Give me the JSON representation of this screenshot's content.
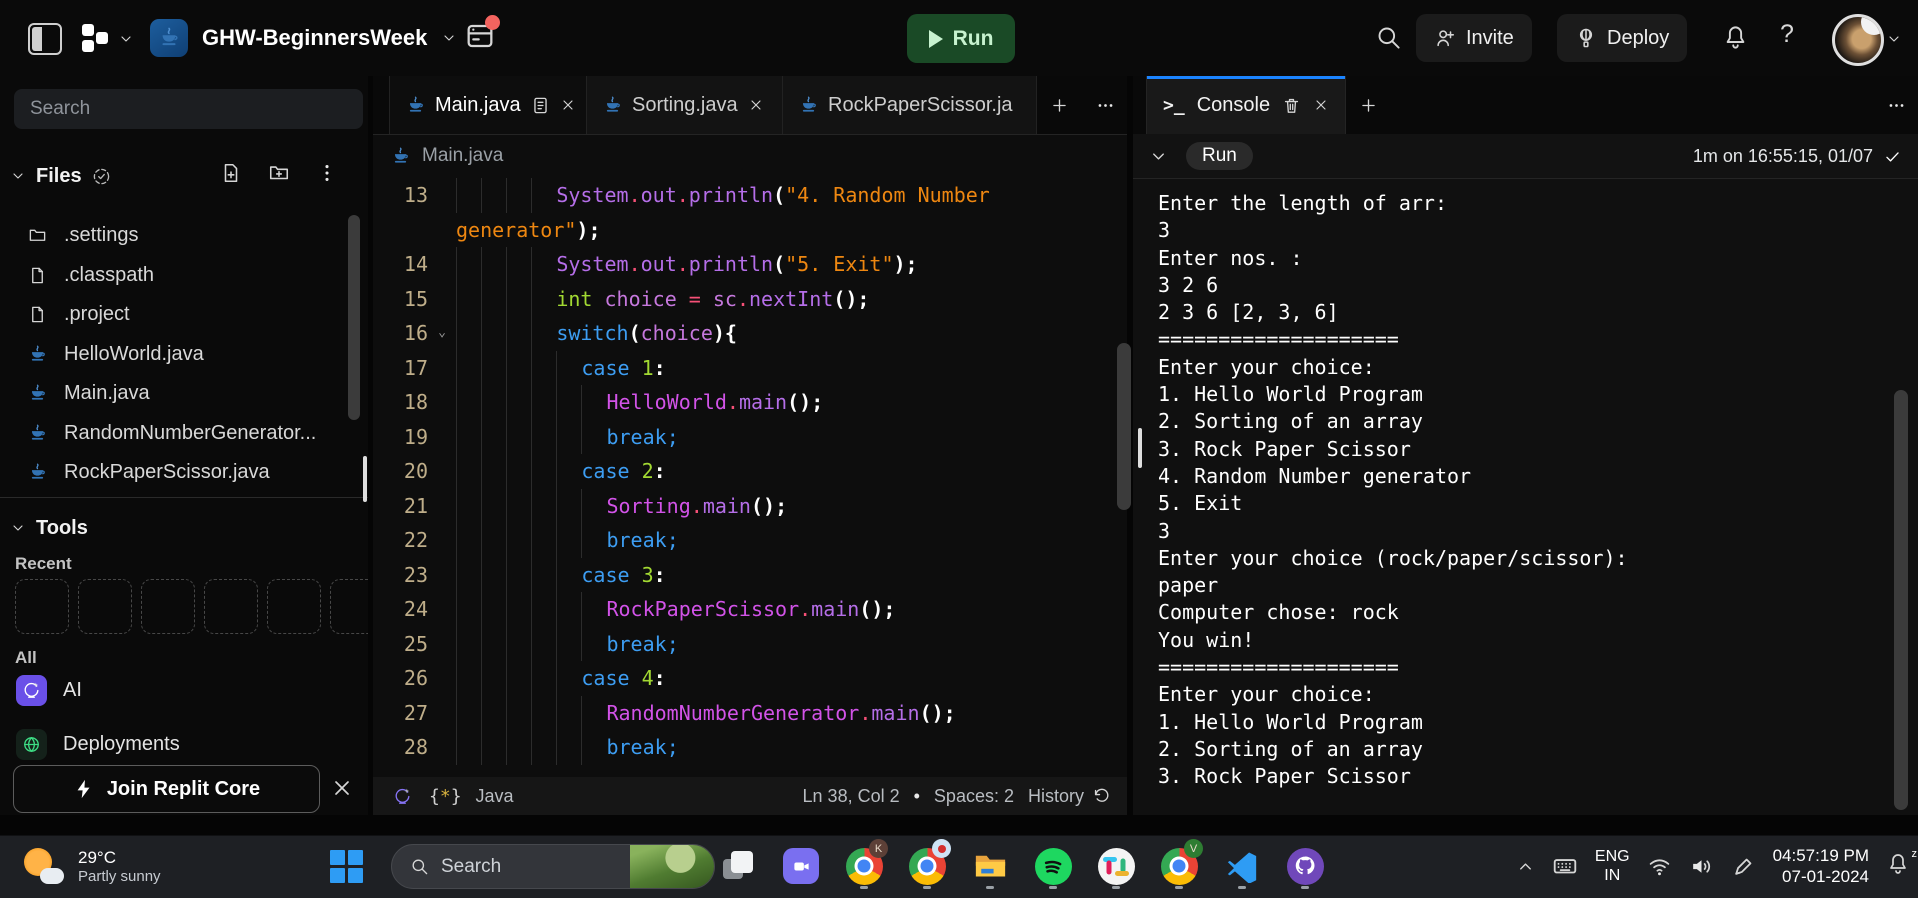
{
  "topbar": {
    "project_name": "GHW-BeginnersWeek",
    "run_label": "Run",
    "invite_label": "Invite",
    "deploy_label": "Deploy",
    "help_label": "?",
    "colors": {
      "run_bg": "#1a4a26",
      "run_text": "#c7f2cf",
      "accent_blue": "#1b84ff",
      "notification_red": "#f4645f"
    }
  },
  "sidebar": {
    "search_placeholder": "Search",
    "files_label": "Files",
    "tools_label": "Tools",
    "recent_label": "Recent",
    "all_label": "All",
    "ai_label": "AI",
    "deployments_label": "Deployments",
    "banner_label": "Join Replit Core",
    "files": [
      {
        "name": ".settings",
        "icon": "folder"
      },
      {
        "name": ".classpath",
        "icon": "file"
      },
      {
        "name": ".project",
        "icon": "file"
      },
      {
        "name": "HelloWorld.java",
        "icon": "java"
      },
      {
        "name": "Main.java",
        "icon": "java"
      },
      {
        "name": "RandomNumberGenerator...",
        "icon": "java"
      },
      {
        "name": "RockPaperScissor.java",
        "icon": "java"
      }
    ]
  },
  "editor": {
    "tabs": [
      {
        "label": "Main.java",
        "active": true,
        "doc": true,
        "close": true
      },
      {
        "label": "Sorting.java",
        "active": false,
        "doc": false,
        "close": true
      },
      {
        "label": "RockPaperScissor.ja",
        "active": false,
        "doc": false,
        "close": false
      }
    ],
    "breadcrumb": "Main.java",
    "status": {
      "lang_label": "Java",
      "position": "Ln 38, Col 2",
      "spaces": "Spaces: 2",
      "history_label": "History"
    },
    "code": {
      "colors": {
        "fn": "#b56ee8",
        "cls": "#d253e8",
        "kw": "#3d9df2",
        "type": "#a2d932",
        "num": "#a2d932",
        "var": "#c678dd",
        "op": "#f65077",
        "str": "#ee8711",
        "pw": "#ffffff"
      },
      "rows": [
        {
          "n": "13",
          "ind": 8,
          "t": [
            [
              "System",
              "fn"
            ],
            [
              ".",
              "op"
            ],
            [
              "out",
              "fn"
            ],
            [
              ".",
              "op"
            ],
            [
              "println",
              "fn"
            ],
            [
              "(",
              "pw"
            ],
            [
              "\"4. Random Number",
              "str"
            ]
          ]
        },
        {
          "n": "",
          "ind": 0,
          "t": [
            [
              "generator\"",
              "str"
            ],
            [
              ");",
              "pw"
            ]
          ]
        },
        {
          "n": "14",
          "ind": 8,
          "t": [
            [
              "System",
              "fn"
            ],
            [
              ".",
              "op"
            ],
            [
              "out",
              "fn"
            ],
            [
              ".",
              "op"
            ],
            [
              "println",
              "fn"
            ],
            [
              "(",
              "pw"
            ],
            [
              "\"5. Exit\"",
              "str"
            ],
            [
              ");",
              "pw"
            ]
          ]
        },
        {
          "n": "15",
          "ind": 8,
          "t": [
            [
              "int",
              "type"
            ],
            [
              " ",
              "pw"
            ],
            [
              "choice",
              "var"
            ],
            [
              " ",
              "pw"
            ],
            [
              "=",
              "op"
            ],
            [
              " ",
              "pw"
            ],
            [
              "sc",
              "var"
            ],
            [
              ".",
              "op"
            ],
            [
              "nextInt",
              "fn"
            ],
            [
              "();",
              "pw"
            ]
          ]
        },
        {
          "n": "16",
          "ind": 8,
          "fold": true,
          "t": [
            [
              "switch",
              "kw"
            ],
            [
              "(",
              "pw"
            ],
            [
              "choice",
              "var"
            ],
            [
              "){",
              "pw"
            ]
          ]
        },
        {
          "n": "17",
          "ind": 10,
          "t": [
            [
              "case",
              "kw"
            ],
            [
              " ",
              "pw"
            ],
            [
              "1",
              "num"
            ],
            [
              ":",
              "pw"
            ]
          ]
        },
        {
          "n": "18",
          "ind": 12,
          "t": [
            [
              "HelloWorld",
              "cls"
            ],
            [
              ".",
              "op"
            ],
            [
              "main",
              "fn"
            ],
            [
              "();",
              "pw"
            ]
          ]
        },
        {
          "n": "19",
          "ind": 12,
          "t": [
            [
              "break",
              "kw"
            ],
            [
              ";",
              "kw"
            ]
          ]
        },
        {
          "n": "20",
          "ind": 10,
          "t": [
            [
              "case",
              "kw"
            ],
            [
              " ",
              "pw"
            ],
            [
              "2",
              "num"
            ],
            [
              ":",
              "pw"
            ]
          ]
        },
        {
          "n": "21",
          "ind": 12,
          "t": [
            [
              "Sorting",
              "cls"
            ],
            [
              ".",
              "op"
            ],
            [
              "main",
              "fn"
            ],
            [
              "();",
              "pw"
            ]
          ]
        },
        {
          "n": "22",
          "ind": 12,
          "t": [
            [
              "break",
              "kw"
            ],
            [
              ";",
              "kw"
            ]
          ]
        },
        {
          "n": "23",
          "ind": 10,
          "t": [
            [
              "case",
              "kw"
            ],
            [
              " ",
              "pw"
            ],
            [
              "3",
              "num"
            ],
            [
              ":",
              "pw"
            ]
          ]
        },
        {
          "n": "24",
          "ind": 12,
          "t": [
            [
              "RockPaperScissor",
              "cls"
            ],
            [
              ".",
              "op"
            ],
            [
              "main",
              "fn"
            ],
            [
              "();",
              "pw"
            ]
          ]
        },
        {
          "n": "25",
          "ind": 12,
          "t": [
            [
              "break",
              "kw"
            ],
            [
              ";",
              "kw"
            ]
          ]
        },
        {
          "n": "26",
          "ind": 10,
          "t": [
            [
              "case",
              "kw"
            ],
            [
              " ",
              "pw"
            ],
            [
              "4",
              "num"
            ],
            [
              ":",
              "pw"
            ]
          ]
        },
        {
          "n": "27",
          "ind": 12,
          "t": [
            [
              "RandomNumberGenerator",
              "cls"
            ],
            [
              ".",
              "op"
            ],
            [
              "main",
              "fn"
            ],
            [
              "();",
              "pw"
            ]
          ]
        },
        {
          "n": "28",
          "ind": 12,
          "t": [
            [
              "break",
              "kw"
            ],
            [
              ";",
              "kw"
            ]
          ]
        }
      ]
    }
  },
  "console": {
    "tab_label": "Console",
    "run_label": "Run",
    "meta": "1m on 16:55:15, 01/07",
    "lines": [
      "Enter the length of arr:",
      "3",
      "Enter nos. :",
      "3 2 6",
      "2 3 6 [2, 3, 6]",
      "====================",
      "Enter your choice:",
      "1. Hello World Program",
      "2. Sorting of an array",
      "3. Rock Paper Scissor",
      "4. Random Number generator",
      "5. Exit",
      "3",
      "Enter your choice (rock/paper/scissor):",
      "paper",
      "Computer chose: rock",
      "You win!",
      "====================",
      "Enter your choice:",
      "1. Hello World Program",
      "2. Sorting of an array",
      "3. Rock Paper Scissor"
    ]
  },
  "taskbar": {
    "weather_temp": "29°C",
    "weather_desc": "Partly sunny",
    "search_label": "Search",
    "tray": {
      "lang_line1": "ENG",
      "lang_line2": "IN",
      "time": "04:57:19 PM",
      "date": "07-01-2024"
    }
  }
}
